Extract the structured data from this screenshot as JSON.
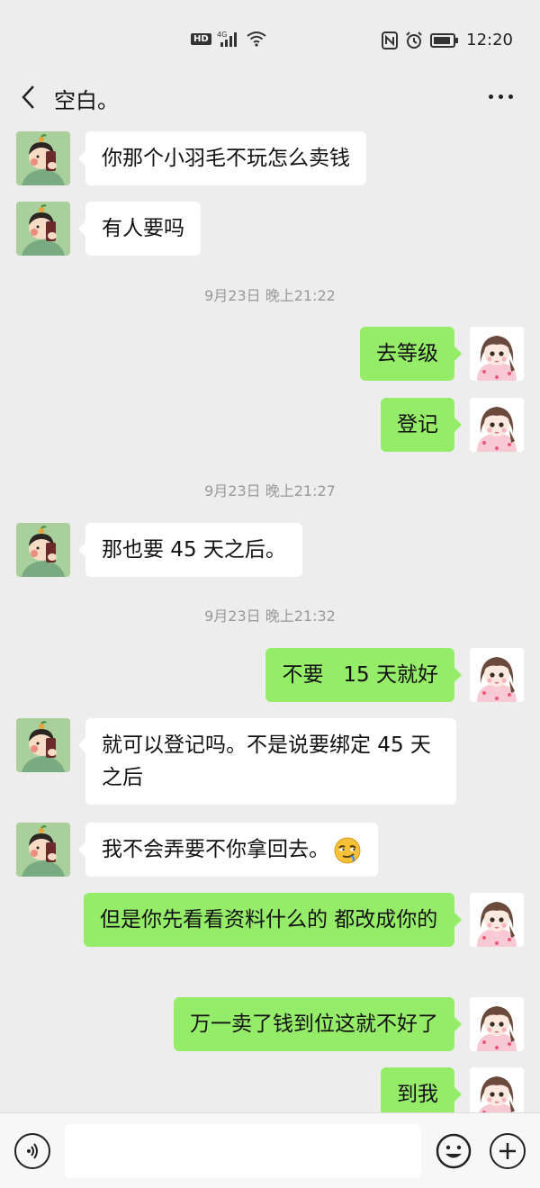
{
  "status_bar": {
    "network_badge": "HD",
    "network_type": "4G",
    "time": "12:20"
  },
  "nav": {
    "title": "空白。"
  },
  "messages": [
    {
      "side": "left",
      "text": "你那个小羽毛不玩怎么卖钱"
    },
    {
      "side": "left",
      "text": "有人要吗"
    },
    {
      "type": "time",
      "text": "9月23日 晚上21:22"
    },
    {
      "side": "right",
      "text": "去等级"
    },
    {
      "side": "right",
      "text": "登记"
    },
    {
      "type": "time",
      "text": "9月23日 晚上21:27"
    },
    {
      "side": "left",
      "text": "那也要 45 天之后。"
    },
    {
      "type": "time",
      "text": "9月23日 晚上21:32"
    },
    {
      "side": "right",
      "text": "不要   15 天就好"
    },
    {
      "side": "left",
      "text": "就可以登记吗。不是说要绑定 45 天之后"
    },
    {
      "side": "left",
      "text": "我不会弄要不你拿回去。",
      "emoji": "smirk-emoji"
    },
    {
      "side": "right",
      "text": "但是你先看看资料什么的 都改成你的"
    },
    {
      "side": "right",
      "text": "万一卖了钱到位这就不好了"
    },
    {
      "side": "right",
      "text": "到我"
    }
  ],
  "colors": {
    "background": "#ededed",
    "sent_bubble": "#95ec69",
    "received_bubble": "#ffffff",
    "timestamp": "#999999"
  }
}
